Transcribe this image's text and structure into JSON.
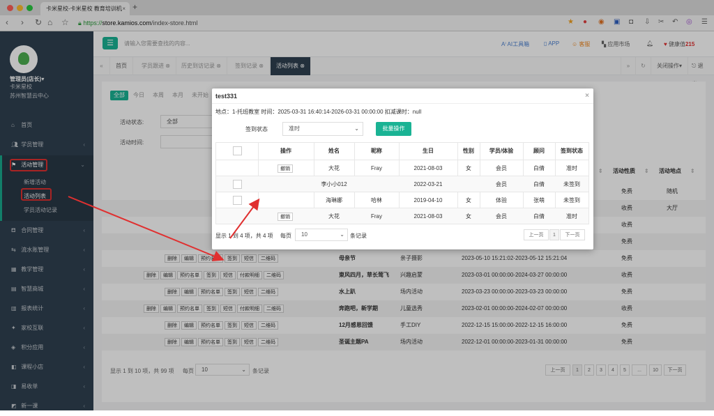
{
  "browser": {
    "tab_title": "卡米星校-卡米星校 教育培训机",
    "url_scheme": "https://",
    "url_host": "store.kamios.com",
    "url_path": "/index-store.html"
  },
  "sidebar": {
    "admin": "管理员(店长)▾",
    "school": "卡米星校",
    "center": "苏州智慧云中心",
    "items": [
      {
        "label": "首页",
        "icon": "home-icon"
      },
      {
        "label": "学员管理",
        "icon": "users-icon"
      },
      {
        "label": "活动管理",
        "icon": "flag-icon"
      },
      {
        "label": "合同管理",
        "icon": "contract-icon"
      },
      {
        "label": "流水账管理",
        "icon": "ledger-icon"
      },
      {
        "label": "教学管理",
        "icon": "calendar-icon"
      },
      {
        "label": "智慧商城",
        "icon": "shop-icon"
      },
      {
        "label": "报表统计",
        "icon": "chart-icon"
      },
      {
        "label": "家校互联",
        "icon": "link-icon"
      },
      {
        "label": "积分应用",
        "icon": "points-icon"
      },
      {
        "label": "课程小店",
        "icon": "store-icon"
      },
      {
        "label": "易收单",
        "icon": "receipt-icon"
      },
      {
        "label": "新一课",
        "icon": "lesson-icon"
      }
    ],
    "sub_items": [
      "新增活动",
      "活动列表",
      "学员活动记录"
    ]
  },
  "topbar": {
    "search_placeholder": "请输入您需要查找的内容...",
    "ai": "AI工具箱",
    "app": "APP",
    "service": "客服",
    "market": "应用市场",
    "health_label": "健康值",
    "health_value": "215"
  },
  "page_tabs": [
    "首页",
    "学员跟进 ⊗",
    "历史到访记录 ⊗",
    "签到记录 ⊗",
    "活动列表 ⊗"
  ],
  "tabbar_right": {
    "close": "关闭操作▾",
    "logout": "退出"
  },
  "filters": {
    "quick": [
      "全部",
      "今日",
      "本周",
      "本月",
      "未开始"
    ],
    "status_label": "活动状态:",
    "status_value": "全部",
    "time_label": "活动时间:"
  },
  "table": {
    "headers": {
      "nature": "活动性质",
      "place": "活动地点"
    },
    "rows": [
      {
        "btns": [
          "删除",
          "编辑",
          "预约名单"
        ],
        "name": "",
        "type": "",
        "time": "",
        "nature": "免费",
        "place": "随机"
      },
      {
        "btns": [
          "删除",
          "编辑",
          "预约名单"
        ],
        "name": "",
        "type": "",
        "time": "",
        "nature": "收费",
        "place": "大厅"
      },
      {
        "btns": [
          "删除",
          "编辑",
          "预约名单"
        ],
        "name": "",
        "type": "",
        "time": "",
        "nature": "收费",
        "place": ""
      },
      {
        "btns": [
          "删除",
          "编辑",
          "预约名单"
        ],
        "name": "",
        "type": "",
        "time": "",
        "nature": "免费",
        "place": ""
      },
      {
        "btns": [
          "删除",
          "编辑",
          "预约名单",
          "签到",
          "短信",
          "二维码"
        ],
        "name": "母亲节",
        "type": "亲子摄影",
        "time": "2023-05-10 15:21:02-2023-05-12 15:21:04",
        "nature": "免费",
        "place": ""
      },
      {
        "btns": [
          "删除",
          "编辑",
          "预约名单",
          "签到",
          "短信",
          "付款明细",
          "二维码"
        ],
        "name": "東风四月，草长莺飞",
        "type": "兴趣启蒙",
        "time": "2023-03-01 00:00:00-2024-03-27 00:00:00",
        "nature": "收费",
        "place": ""
      },
      {
        "btns": [
          "删除",
          "编辑",
          "预约名单",
          "签到",
          "短信",
          "二维码"
        ],
        "name": "水上趴",
        "type": "场内活动",
        "time": "2023-03-23 00:00:00-2023-03-23 00:00:00",
        "nature": "免费",
        "place": ""
      },
      {
        "btns": [
          "删除",
          "编辑",
          "预约名单",
          "签到",
          "短信",
          "付款明细",
          "二维码"
        ],
        "name": "奔跑吧，新学期",
        "type": "儿童选秀",
        "time": "2023-02-01 00:00:00-2024-02-07 00:00:00",
        "nature": "收费",
        "place": ""
      },
      {
        "btns": [
          "删除",
          "编辑",
          "预约名单",
          "签到",
          "短信",
          "二维码"
        ],
        "name": "12月感恩回馈",
        "type": "手工DIY",
        "time": "2022-12-15 15:00:00-2022-12-15 16:00:00",
        "nature": "免费",
        "place": ""
      },
      {
        "btns": [
          "删除",
          "编辑",
          "预约名单",
          "签到",
          "短信",
          "二维码"
        ],
        "name": "圣诞主题PA",
        "type": "场内活动",
        "time": "2022-12-01 00:00:00-2023-01-31 00:00:00",
        "nature": "免费",
        "place": ""
      }
    ],
    "footer": {
      "summary": "显示 1 到 10 项，共 99 项",
      "per_page": "每页",
      "per_value": "10",
      "records": "条记录"
    },
    "pages": [
      "上一页",
      "1",
      "2",
      "3",
      "4",
      "5",
      "...",
      "10",
      "下一页"
    ]
  },
  "modal": {
    "title": "test331",
    "info": "地点：1-托班教室   时间：2025-03-31 16:40:14-2026-03-31 00:00:00   扣减课时：null",
    "signin_label": "签到状态",
    "signin_value": "准时",
    "batch": "批量操作",
    "headers": [
      "",
      "操作",
      "姓名",
      "昵称",
      "生日",
      "性别",
      "学员/体验",
      "顾问",
      "签到状态"
    ],
    "rows": [
      {
        "check": false,
        "op": "撤销",
        "name": "大花",
        "nick": "Fray",
        "birth": "2021-08-03",
        "gender": "女",
        "kind": "会员",
        "adviser": "白倩",
        "status": "准时"
      },
      {
        "check": true,
        "op": "",
        "name": "李小小012",
        "nick": "",
        "birth": "2022-03-21",
        "gender": "",
        "kind": "会员",
        "adviser": "白倩",
        "status": "未签到"
      },
      {
        "check": true,
        "op": "",
        "name": "海琳娜",
        "nick": "哈林",
        "birth": "2019-04-10",
        "gender": "女",
        "kind": "体验",
        "adviser": "张萌",
        "status": "未签到"
      },
      {
        "check": false,
        "op": "撤销",
        "name": "大花",
        "nick": "Fray",
        "birth": "2021-08-03",
        "gender": "女",
        "kind": "会员",
        "adviser": "白倩",
        "status": "准时"
      }
    ],
    "footer": {
      "summary": "显示 1 到 4 项，共 4 项",
      "per_page": "每页",
      "per_value": "10",
      "records": "条记录"
    },
    "pages": [
      "上一页",
      "1",
      "下一页"
    ]
  }
}
